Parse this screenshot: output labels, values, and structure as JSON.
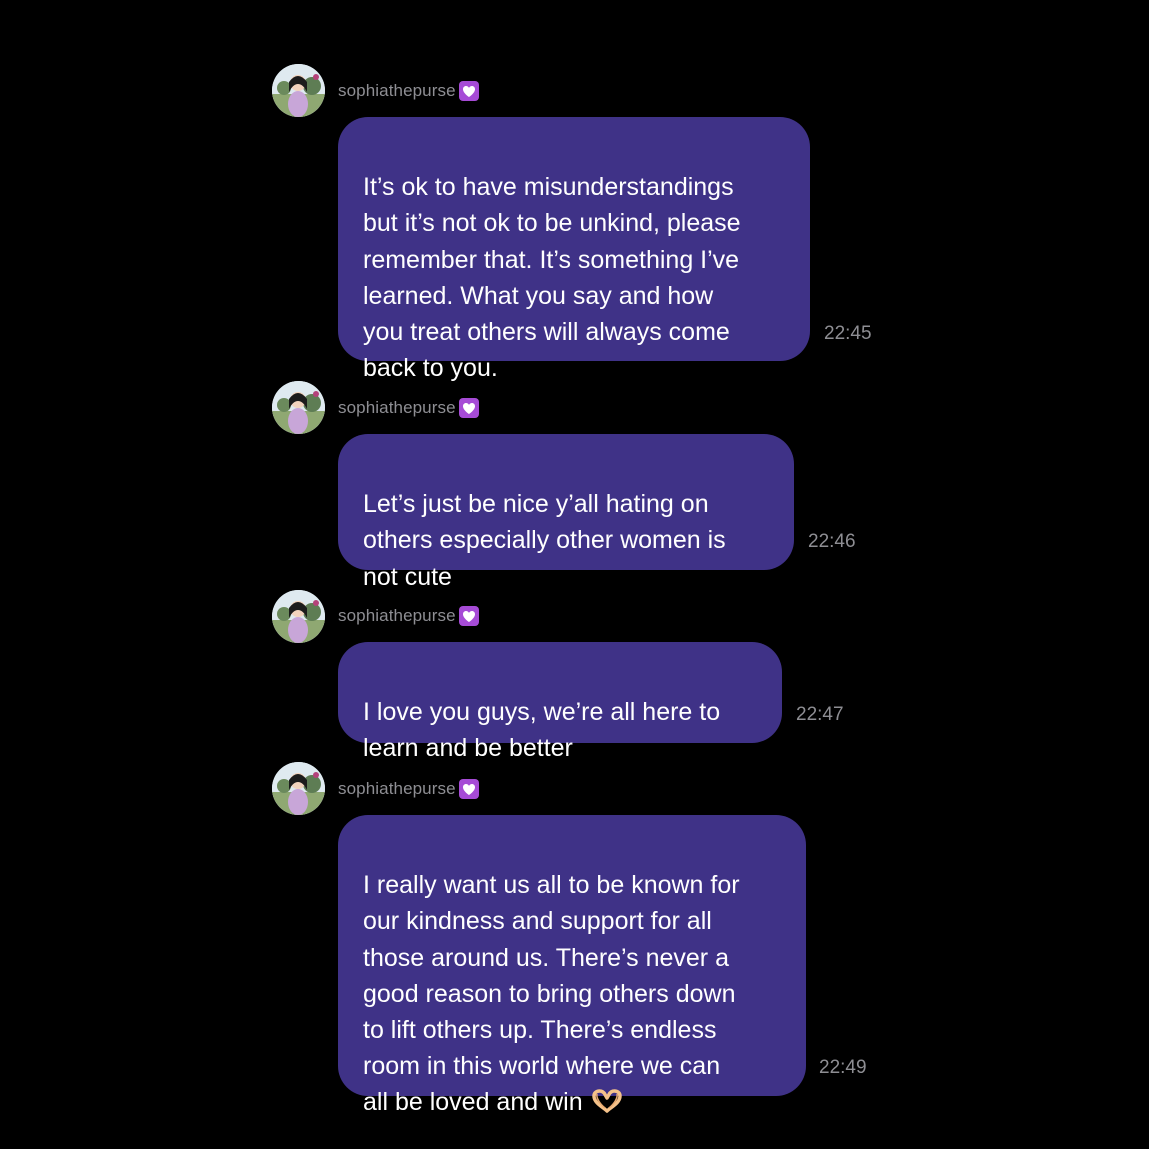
{
  "conversation": {
    "messages": [
      {
        "username": "sophiathepurse",
        "badge_icon": "purple-heart-icon",
        "text": "It’s ok to have misunderstandings\nbut it’s not ok to be unkind, please\nremember that. It’s something I’ve\nlearned. What you say and how\nyou treat others will always come\nback to you.",
        "time": "22:45"
      },
      {
        "username": "sophiathepurse",
        "badge_icon": "purple-heart-icon",
        "text": "Let’s just be nice y’all hating on\nothers especially other women is\nnot cute",
        "time": "22:46"
      },
      {
        "username": "sophiathepurse",
        "badge_icon": "purple-heart-icon",
        "text": "I love you guys, we’re all here to\nlearn and be better",
        "time": "22:47"
      },
      {
        "username": "sophiathepurse",
        "badge_icon": "purple-heart-icon",
        "text": "I really want us all to be known for\nour kindness and support for all\nthose around us. There’s never a\ngood reason to bring others down\nto lift others up. There’s endless\nroom in this world where we can\nall be loved and win",
        "trailing_emoji": "heart-hands-emoji",
        "time": "22:49"
      }
    ]
  },
  "colors": {
    "background": "#000000",
    "bubble": "#3f3287",
    "message_text": "#ffffff",
    "meta_text": "#8e8e93",
    "heart_badge": "#a64bd6"
  }
}
